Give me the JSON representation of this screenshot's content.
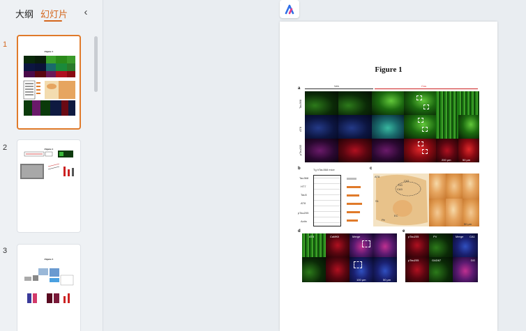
{
  "sidebar": {
    "tabs": {
      "outline": "大纲",
      "slides": "幻灯片"
    },
    "collapse_icon": "chevron-left-icon",
    "slides": [
      {
        "number": "1",
        "title": "Figure 1",
        "active": true
      },
      {
        "number": "2",
        "title": "Figure 2",
        "active": false
      },
      {
        "number": "3",
        "title": "Figure 3",
        "active": false
      }
    ]
  },
  "canvas": {
    "logo_icon": "app-logo-icon",
    "figure_title": "Figure 1",
    "labels": {
      "a": "a",
      "b": "b",
      "c": "c",
      "d": "d",
      "e": "e",
      "veh": "Veh",
      "cns": "Cns",
      "ca1": "CA1",
      "dg": "DG",
      "row_tau": "Tau368",
      "row_at8": "AT8",
      "row_ptau": "pTau205",
      "scale_200": "200 μm",
      "scale_50": "50 μm",
      "scale_100": "100 μm",
      "tg_mice": "Tg hTau368 mice",
      "blot_rows": [
        "Tau368",
        "HT7",
        "Tau5",
        "AT8",
        "pTau205",
        "Actin"
      ],
      "c_at8": "AT8",
      "c_ca1": "CA1",
      "c_ca3": "CA3",
      "c_dg": "DG",
      "c_ec": "EC",
      "c_pir": "Pir",
      "c_s1": "S1",
      "d_headers": [
        "AT8",
        "CaMKII",
        "Merge"
      ],
      "e_headers": [
        "pTau205",
        "PV",
        "Merge"
      ],
      "e_headers_row2": [
        "pTau205",
        "GAD67"
      ]
    }
  },
  "colors": {
    "accent": "#d4661c",
    "active_border": "#e07a2a"
  }
}
